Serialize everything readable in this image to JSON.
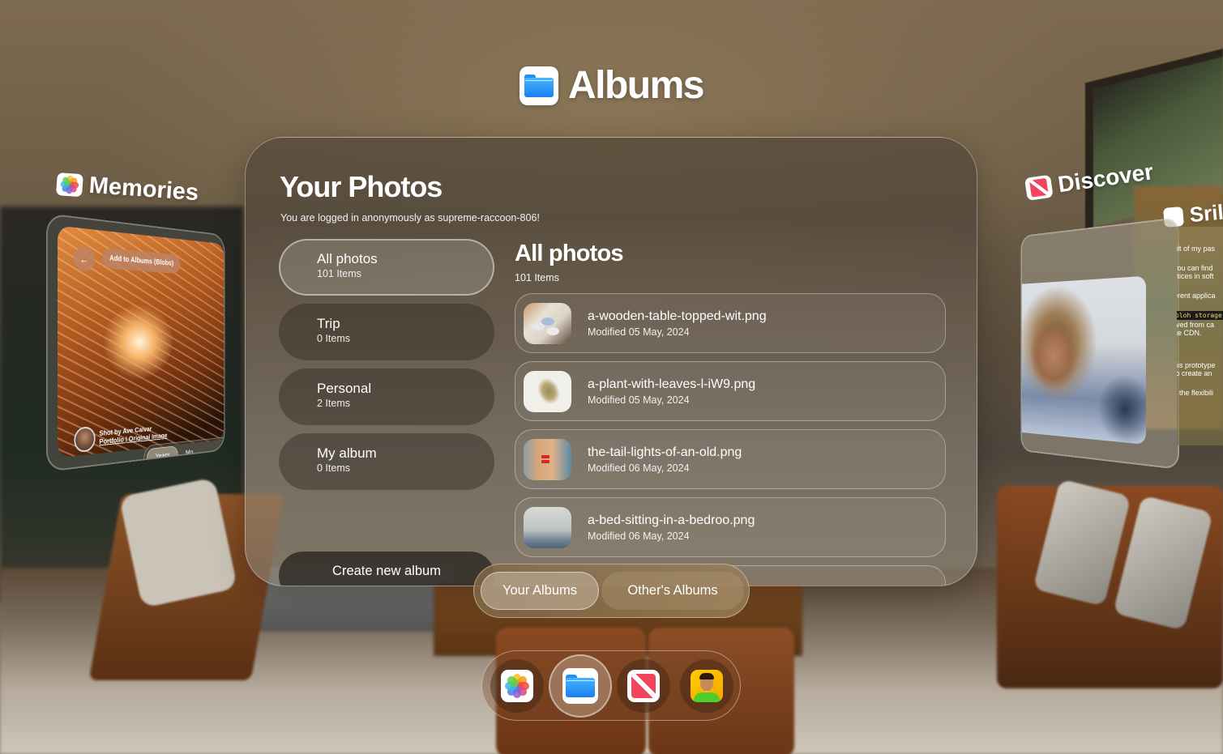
{
  "app": {
    "title": "Albums",
    "icon": "folder-icon"
  },
  "main": {
    "heading": "Your Photos",
    "logged_in_text": "You are logged in anonymously as supreme-raccoon-806!",
    "albums": [
      {
        "name": "All photos",
        "count": "101 Items",
        "active": true
      },
      {
        "name": "Trip",
        "count": "0 Items",
        "active": false
      },
      {
        "name": "Personal",
        "count": "2 Items",
        "active": false
      },
      {
        "name": "My album",
        "count": "0 Items",
        "active": false
      }
    ],
    "create_album_label": "Create new album",
    "photos_panel": {
      "title": "All photos",
      "count": "101 Items",
      "photos": [
        {
          "filename": "a-wooden-table-topped-wit.png",
          "modified": "Modified 05 May, 2024"
        },
        {
          "filename": "a-plant-with-leaves-l-iW9.png",
          "modified": "Modified 05 May, 2024"
        },
        {
          "filename": "the-tail-lights-of-an-old.png",
          "modified": "Modified 06 May, 2024"
        },
        {
          "filename": "a-bed-sitting-in-a-bedroo.png",
          "modified": "Modified 06 May, 2024"
        }
      ]
    }
  },
  "segmented": {
    "options": [
      "Your Albums",
      "Other's Albums"
    ],
    "selected": "Your Albums"
  },
  "dock": {
    "items": [
      {
        "name": "Photos",
        "icon": "photos-flower-icon",
        "active": false
      },
      {
        "name": "Albums",
        "icon": "folder-icon",
        "active": true
      },
      {
        "name": "Discover",
        "icon": "news-icon",
        "active": false
      },
      {
        "name": "Profile",
        "icon": "avatar-icon",
        "active": false
      }
    ]
  },
  "side_windows": {
    "memories": {
      "label": "Memories",
      "back_label": "←",
      "add_label": "Add to Albums (Blobs)",
      "credit_line": "Shot by Ave Calvar",
      "credit_links": "Portfolio | Original Image",
      "tabs": [
        "Years",
        "Mo"
      ],
      "selected_tab": "Years"
    },
    "discover": {
      "label": "Discover"
    },
    "sril": {
      "label": "Sril",
      "snippets": [
        "ult of my pas",
        "you can find",
        "ctices in soft",
        "erent applica",
        "bloh storage",
        "rved from ca",
        "ge CDN.",
        "his prototype",
        "to create an",
        "s the flexibili"
      ]
    }
  },
  "colors": {
    "folder_blue": "#1a7ff0",
    "news_red": "#f0455c",
    "avatar_yellow": "#ffcc00"
  }
}
